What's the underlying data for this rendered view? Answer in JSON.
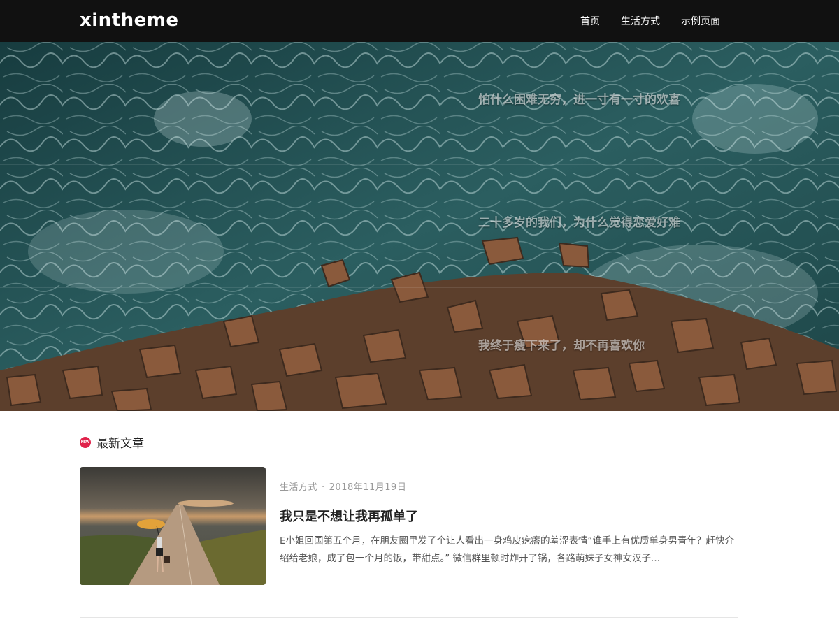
{
  "header": {
    "logo": "xintheme",
    "nav": [
      {
        "label": "首页"
      },
      {
        "label": "生活方式"
      },
      {
        "label": "示例页面"
      }
    ]
  },
  "hero": {
    "slides": [
      {
        "caption": "怕什么困难无穷，进一寸有一寸的欢喜"
      },
      {
        "caption": "二十多岁的我们，为什么觉得恋爱好难"
      },
      {
        "caption": "我终于瘦下来了，却不再喜欢你"
      }
    ]
  },
  "latest": {
    "badge": "NEW",
    "title": "最新文章",
    "posts": [
      {
        "category": "生活方式",
        "separator": "·",
        "date": "2018年11月19日",
        "title": "我只是不想让我再孤单了",
        "excerpt": "E小姐回国第五个月，在朋友圈里发了个让人看出一身鸡皮疙瘩的羞涩表情“谁手上有优质单身男青年？赶快介绍给老娘，成了包一个月的饭，带甜点。” 微信群里顿时炸开了锅，各路萌妹子女神女汉子..."
      }
    ]
  },
  "colors": {
    "header_bg": "#111111",
    "accent": "#e0224a",
    "sea": "#1f4a4c",
    "rock": "#8a5a3c"
  }
}
